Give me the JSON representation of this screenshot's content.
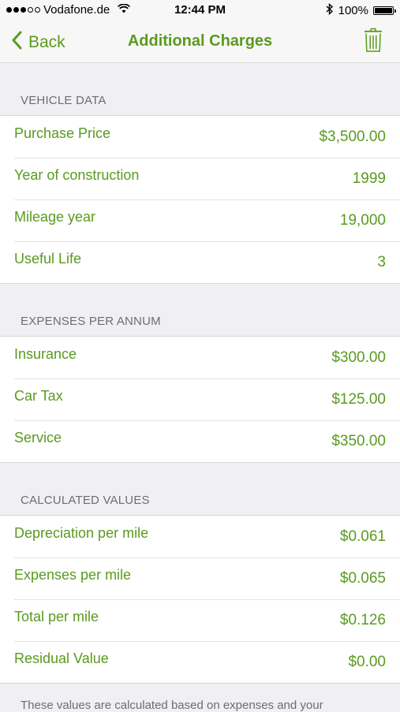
{
  "status_bar": {
    "carrier": "Vodafone.de",
    "time": "12:44 PM",
    "battery": "100%"
  },
  "nav": {
    "back_label": "Back",
    "title": "Additional Charges"
  },
  "sections": {
    "vehicle": {
      "header": "VEHICLE DATA",
      "rows": [
        {
          "label": "Purchase Price",
          "value": "$3,500.00"
        },
        {
          "label": "Year of construction",
          "value": "1999"
        },
        {
          "label": "Mileage year",
          "value": "19,000"
        },
        {
          "label": "Useful Life",
          "value": "3"
        }
      ]
    },
    "expenses": {
      "header": "EXPENSES PER ANNUM",
      "rows": [
        {
          "label": "Insurance",
          "value": "$300.00"
        },
        {
          "label": "Car Tax",
          "value": "$125.00"
        },
        {
          "label": "Service",
          "value": "$350.00"
        }
      ]
    },
    "calculated": {
      "header": "CALCULATED VALUES",
      "rows": [
        {
          "label": "Depreciation per mile",
          "value": "$0.061"
        },
        {
          "label": "Expenses per mile",
          "value": "$0.065"
        },
        {
          "label": "Total per mile",
          "value": "$0.126"
        },
        {
          "label": "Residual Value",
          "value": "$0.00"
        }
      ]
    }
  },
  "footer": {
    "text": "These values are calculated based on expenses and your"
  },
  "colors": {
    "accent": "#5a9a1f",
    "section_header": "#6d6d72",
    "background": "#efeff4"
  },
  "icons": {
    "back": "chevron-left-icon",
    "trash": "trash-icon",
    "wifi": "wifi-icon",
    "bluetooth": "bluetooth-icon",
    "battery": "battery-icon"
  }
}
